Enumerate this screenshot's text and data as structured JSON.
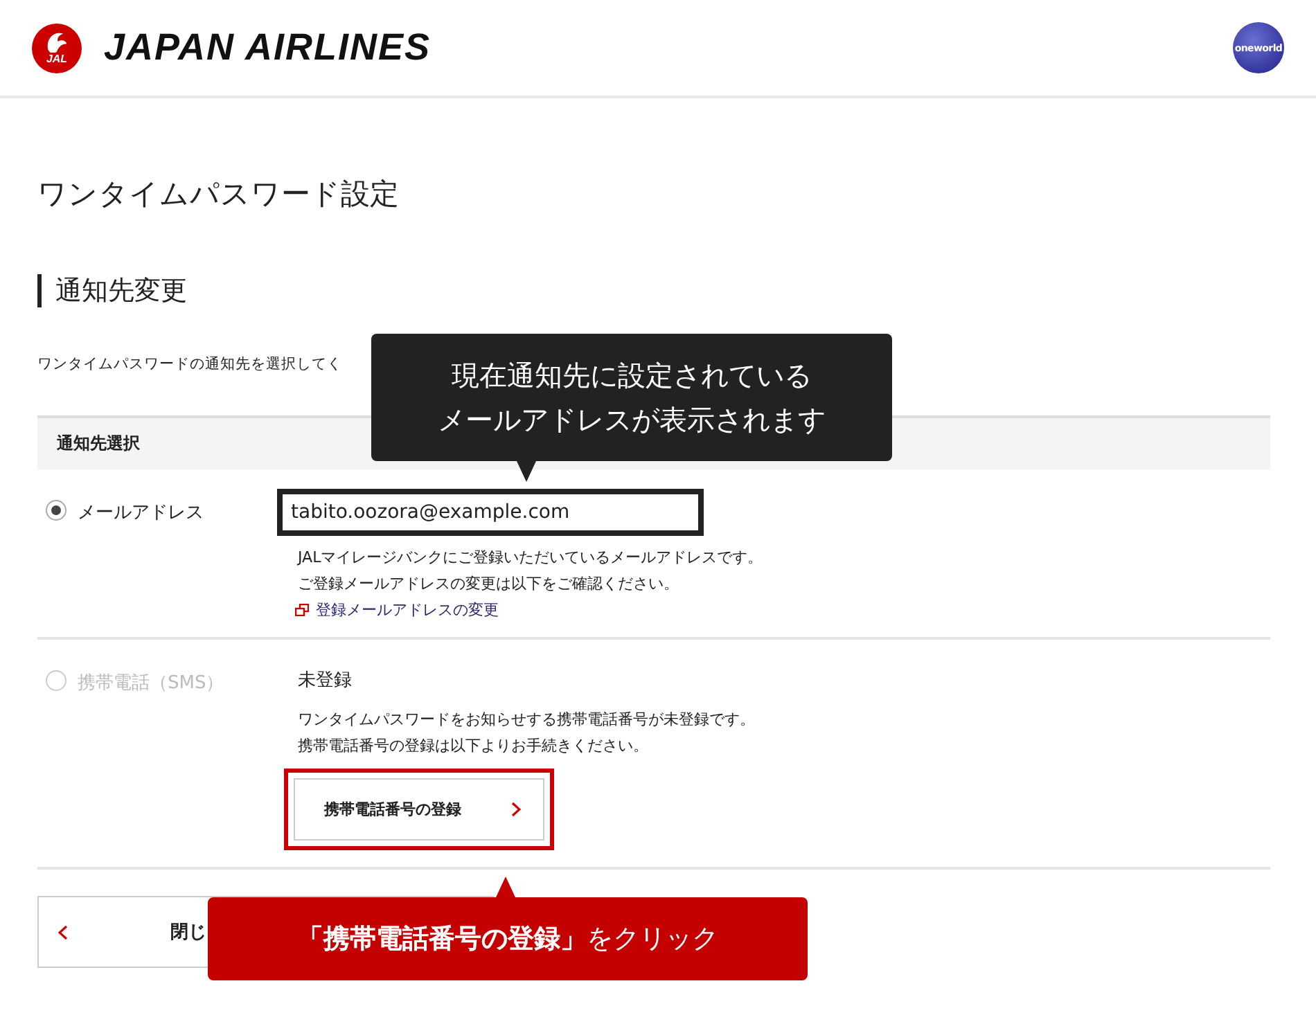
{
  "header": {
    "logo_mark_text": "JAL",
    "brand": "JAPAN AIRLINES",
    "alliance": "oneworld"
  },
  "page_title": "ワンタイムパスワード設定",
  "section_title": "通知先変更",
  "intro": "ワンタイムパスワードの通知先を選択してく",
  "table_header": "通知先選択",
  "options": [
    {
      "kind": "email",
      "label": "メールアドレス",
      "selected": true,
      "disabled": false,
      "value": "tabito.oozora@example.com",
      "highlighted": true,
      "notes": [
        "JALマイレージバンクにご登録いただいているメールアドレスです。",
        "ご登録メールアドレスの変更は以下をご確認ください。"
      ],
      "link": "登録メールアドレスの変更"
    },
    {
      "kind": "sms",
      "label": "携帯電話（SMS）",
      "selected": false,
      "disabled": true,
      "status": "未登録",
      "notes": [
        "ワンタイムパスワードをお知らせする携帯電話番号が未登録です。",
        "携帯電話番号の登録は以下よりお手続きください。"
      ],
      "button": "携帯電話番号の登録",
      "highlighted": true
    }
  ],
  "close_button": "閉じ",
  "callouts": [
    {
      "kind": "dark",
      "lines": [
        "現在通知先に設定されている",
        "メールアドレスが表示されます"
      ]
    },
    {
      "kind": "red",
      "text": "**「携帯電話番号の登録」**をクリック"
    }
  ]
}
